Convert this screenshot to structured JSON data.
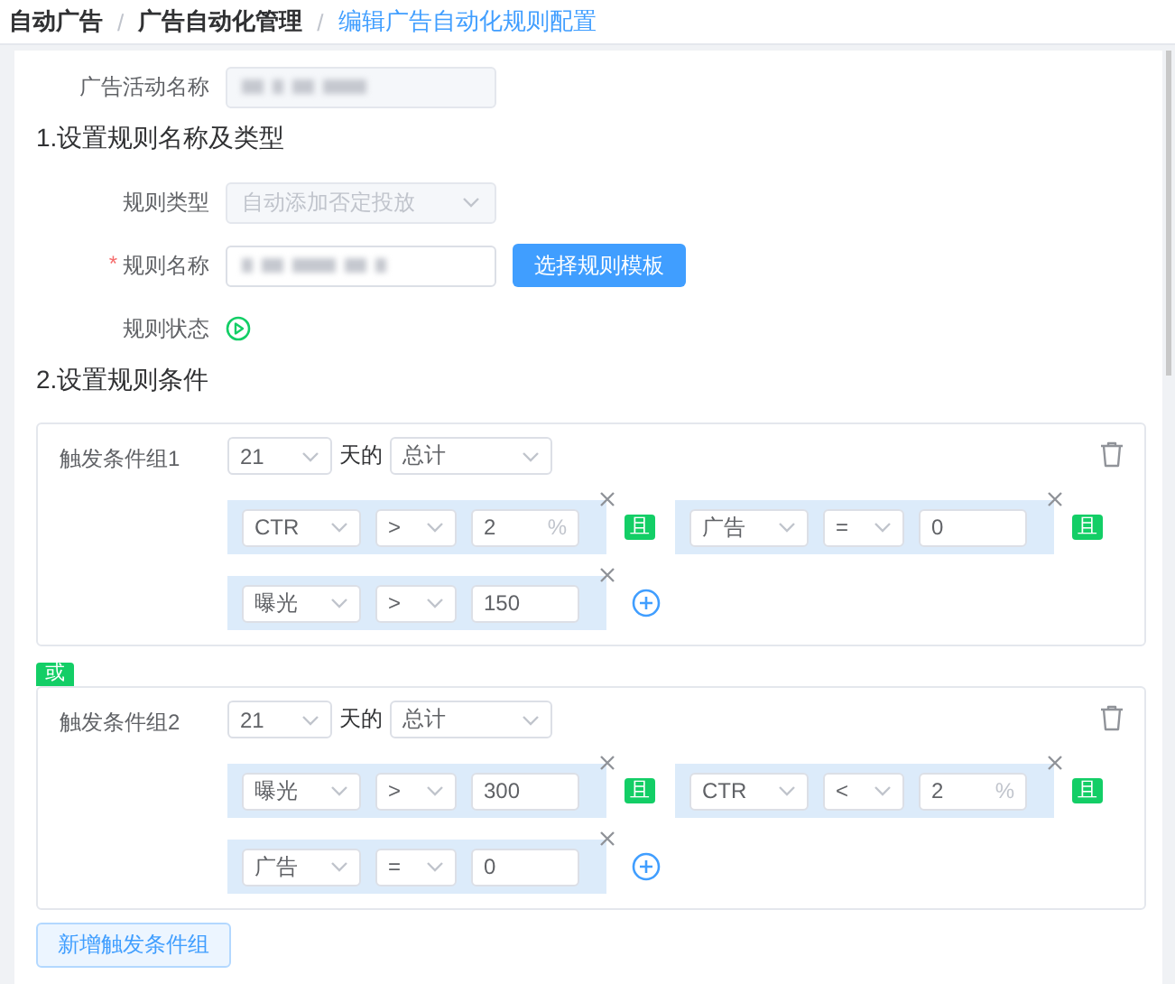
{
  "breadcrumb_separator": "/",
  "breadcrumb": [
    {
      "label": "自动广告",
      "current": false
    },
    {
      "label": "广告自动化管理",
      "current": false
    },
    {
      "label": "编辑广告自动化规则配置",
      "current": true
    }
  ],
  "campaign": {
    "label": "广告活动名称"
  },
  "section_1": "1.设置规则名称及类型",
  "rule_type": {
    "label": "规则类型",
    "value": "自动添加否定投放",
    "disabled": true
  },
  "rule_name": {
    "label": "规则名称",
    "required_mark": "*",
    "button": "选择规则模板"
  },
  "rule_status": {
    "label": "规则状态"
  },
  "section_2": "2.设置规则条件",
  "groups": [
    {
      "label": "触发条件组1",
      "days": "21",
      "days_suffix": "天的",
      "period": "总计",
      "conditions": [
        {
          "metric": "CTR",
          "operator": ">",
          "value": "2",
          "unit": "%",
          "joiner": "且"
        },
        {
          "metric": "广告",
          "operator": "=",
          "value": "0",
          "joiner": "且"
        },
        {
          "metric": "曝光",
          "operator": ">",
          "value": "150"
        }
      ]
    },
    {
      "or_label": "或",
      "label": "触发条件组2",
      "days": "21",
      "days_suffix": "天的",
      "period": "总计",
      "conditions": [
        {
          "metric": "曝光",
          "operator": ">",
          "value": "300",
          "joiner": "且"
        },
        {
          "metric": "CTR",
          "operator": "<",
          "value": "2",
          "unit": "%",
          "joiner": "且"
        },
        {
          "metric": "广告",
          "operator": "=",
          "value": "0"
        }
      ]
    }
  ],
  "add_group_button": "新增触发条件组"
}
